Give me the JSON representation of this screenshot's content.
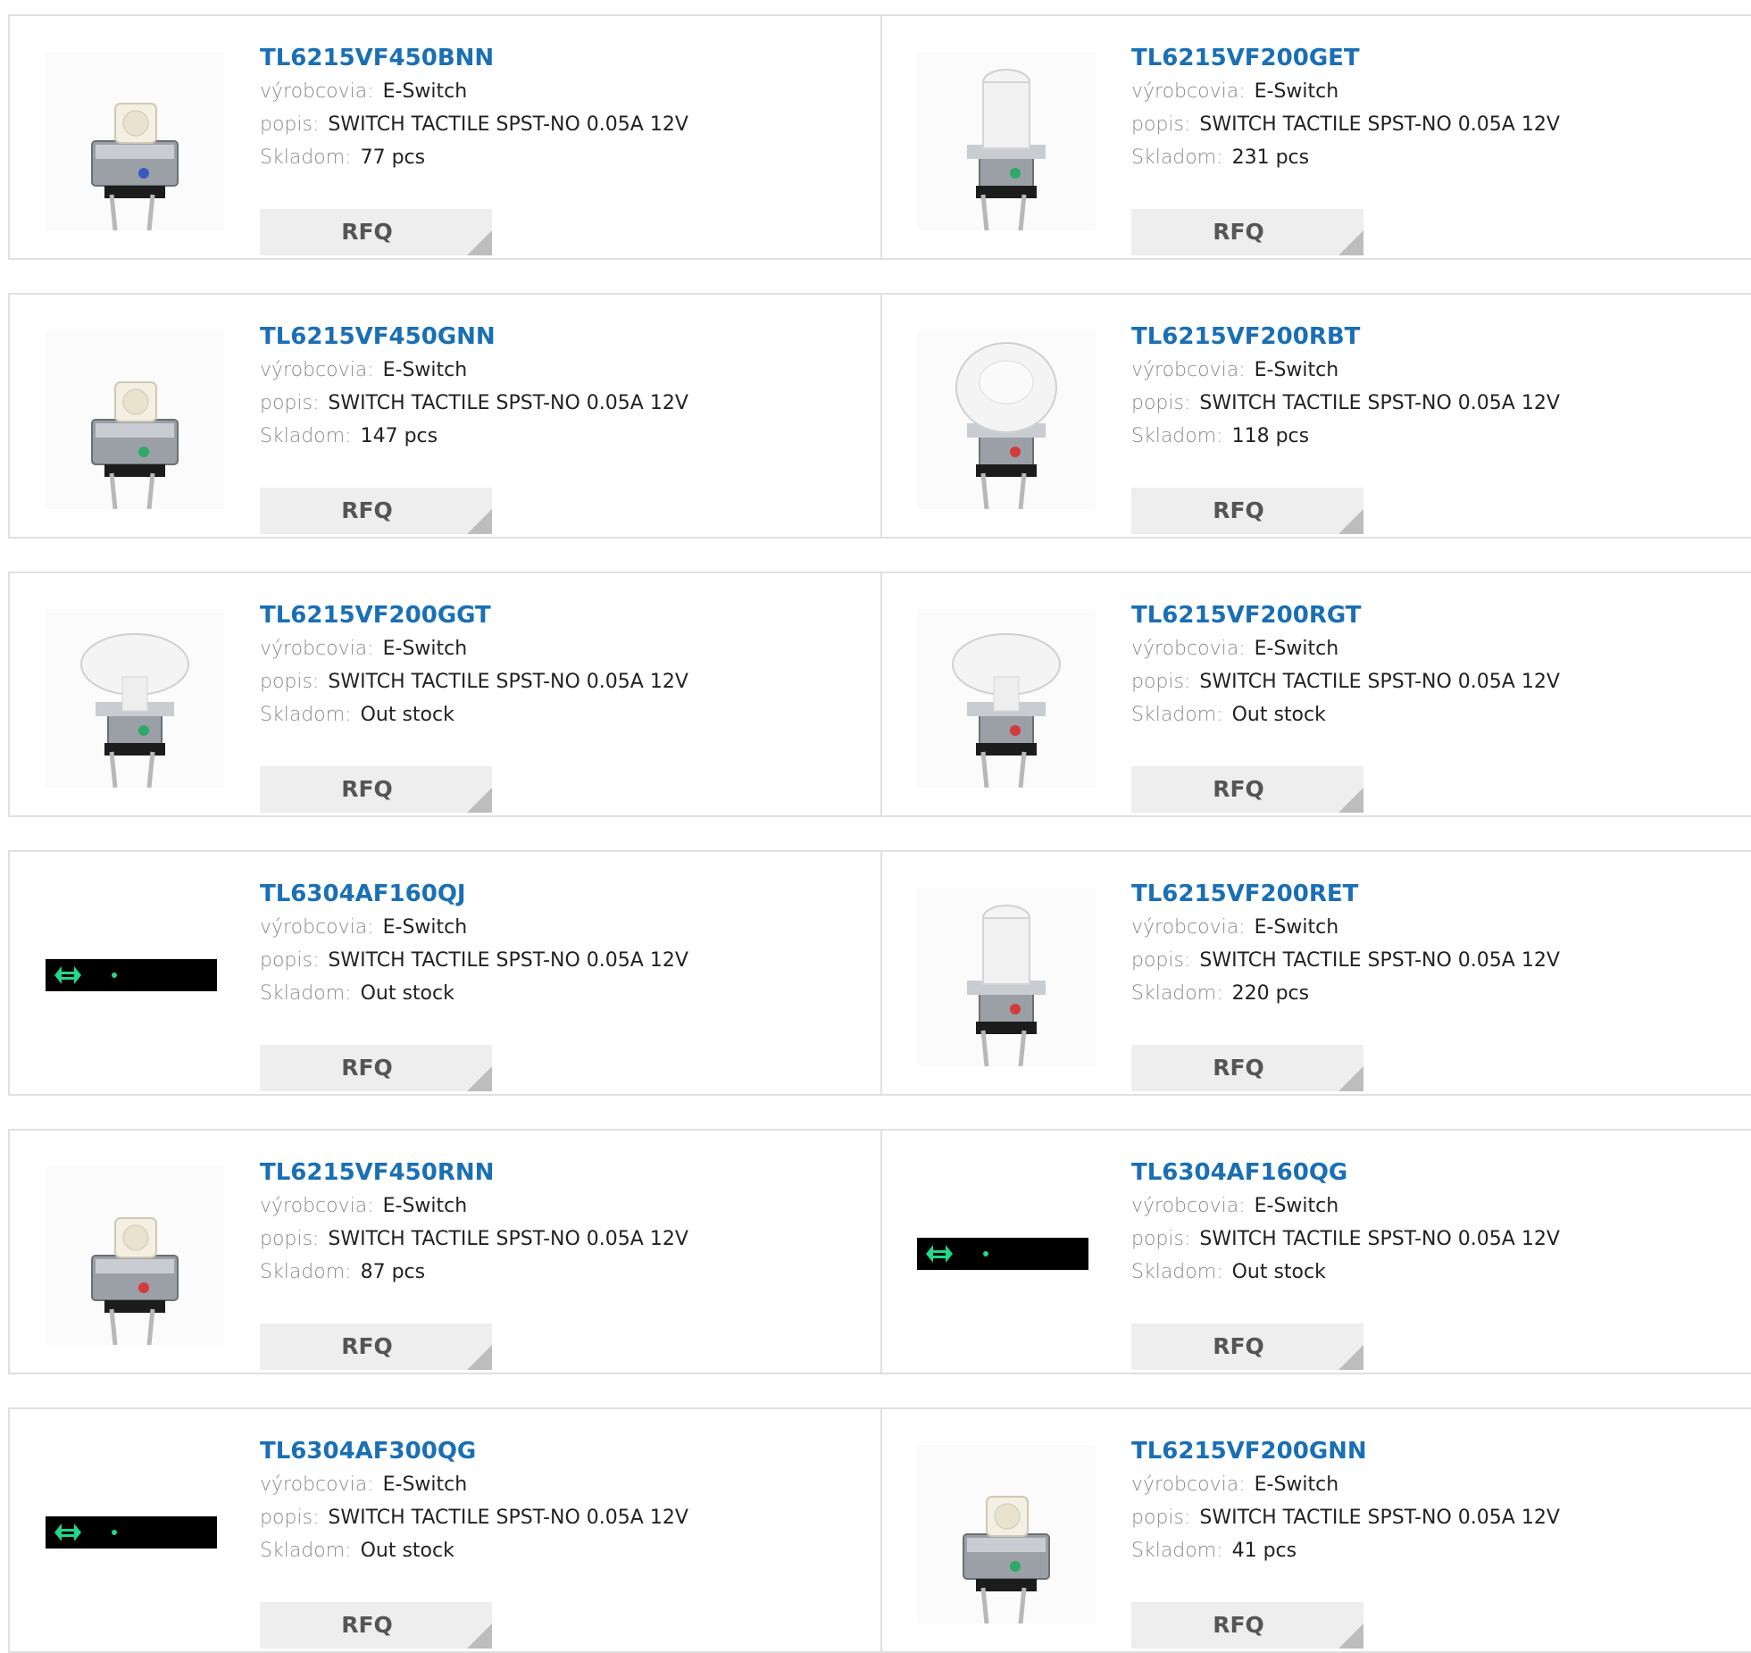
{
  "labels": {
    "manufacturer": "výrobcovia:",
    "description": "popis:",
    "stock": "Skladom:",
    "rfq": "RFQ"
  },
  "products": [
    {
      "part": "TL6215VF450BNN",
      "manufacturer": "E-Switch",
      "description": "SWITCH TACTILE SPST-NO 0.05A 12V",
      "stock": "77 pcs",
      "image": "switch-square",
      "dot": "#3b57c4"
    },
    {
      "part": "TL6215VF200GET",
      "manufacturer": "E-Switch",
      "description": "SWITCH TACTILE SPST-NO 0.05A 12V",
      "stock": "231 pcs",
      "image": "switch-tall-cap",
      "dot": "#2fa86a"
    },
    {
      "part": "TL6215VF450GNN",
      "manufacturer": "E-Switch",
      "description": "SWITCH TACTILE SPST-NO 0.05A 12V",
      "stock": "147 pcs",
      "image": "switch-square",
      "dot": "#2fa86a"
    },
    {
      "part": "TL6215VF200RBT",
      "manufacturer": "E-Switch",
      "description": "SWITCH TACTILE SPST-NO 0.05A 12V",
      "stock": "118 pcs",
      "image": "switch-round-cap",
      "dot": "#d23b3b"
    },
    {
      "part": "TL6215VF200GGT",
      "manufacturer": "E-Switch",
      "description": "SWITCH TACTILE SPST-NO 0.05A 12V",
      "stock": "Out stock",
      "image": "switch-oval-cap",
      "dot": "#2fa86a"
    },
    {
      "part": "TL6215VF200RGT",
      "manufacturer": "E-Switch",
      "description": "SWITCH TACTILE SPST-NO 0.05A 12V",
      "stock": "Out stock",
      "image": "switch-oval-cap",
      "dot": "#d23b3b"
    },
    {
      "part": "TL6304AF160QJ",
      "manufacturer": "E-Switch",
      "description": "SWITCH TACTILE SPST-NO 0.05A 12V",
      "stock": "Out stock",
      "image": "broken-image",
      "dot": "#22d68a"
    },
    {
      "part": "TL6215VF200RET",
      "manufacturer": "E-Switch",
      "description": "SWITCH TACTILE SPST-NO 0.05A 12V",
      "stock": "220 pcs",
      "image": "switch-tall-cap",
      "dot": "#d23b3b"
    },
    {
      "part": "TL6215VF450RNN",
      "manufacturer": "E-Switch",
      "description": "SWITCH TACTILE SPST-NO 0.05A 12V",
      "stock": "87 pcs",
      "image": "switch-square",
      "dot": "#d23b3b"
    },
    {
      "part": "TL6304AF160QG",
      "manufacturer": "E-Switch",
      "description": "SWITCH TACTILE SPST-NO 0.05A 12V",
      "stock": "Out stock",
      "image": "broken-image",
      "dot": "#22d68a"
    },
    {
      "part": "TL6304AF300QG",
      "manufacturer": "E-Switch",
      "description": "SWITCH TACTILE SPST-NO 0.05A 12V",
      "stock": "Out stock",
      "image": "broken-image",
      "dot": "#22d68a"
    },
    {
      "part": "TL6215VF200GNN",
      "manufacturer": "E-Switch",
      "description": "SWITCH TACTILE SPST-NO 0.05A 12V",
      "stock": "41 pcs",
      "image": "switch-square",
      "dot": "#2fa86a"
    }
  ]
}
